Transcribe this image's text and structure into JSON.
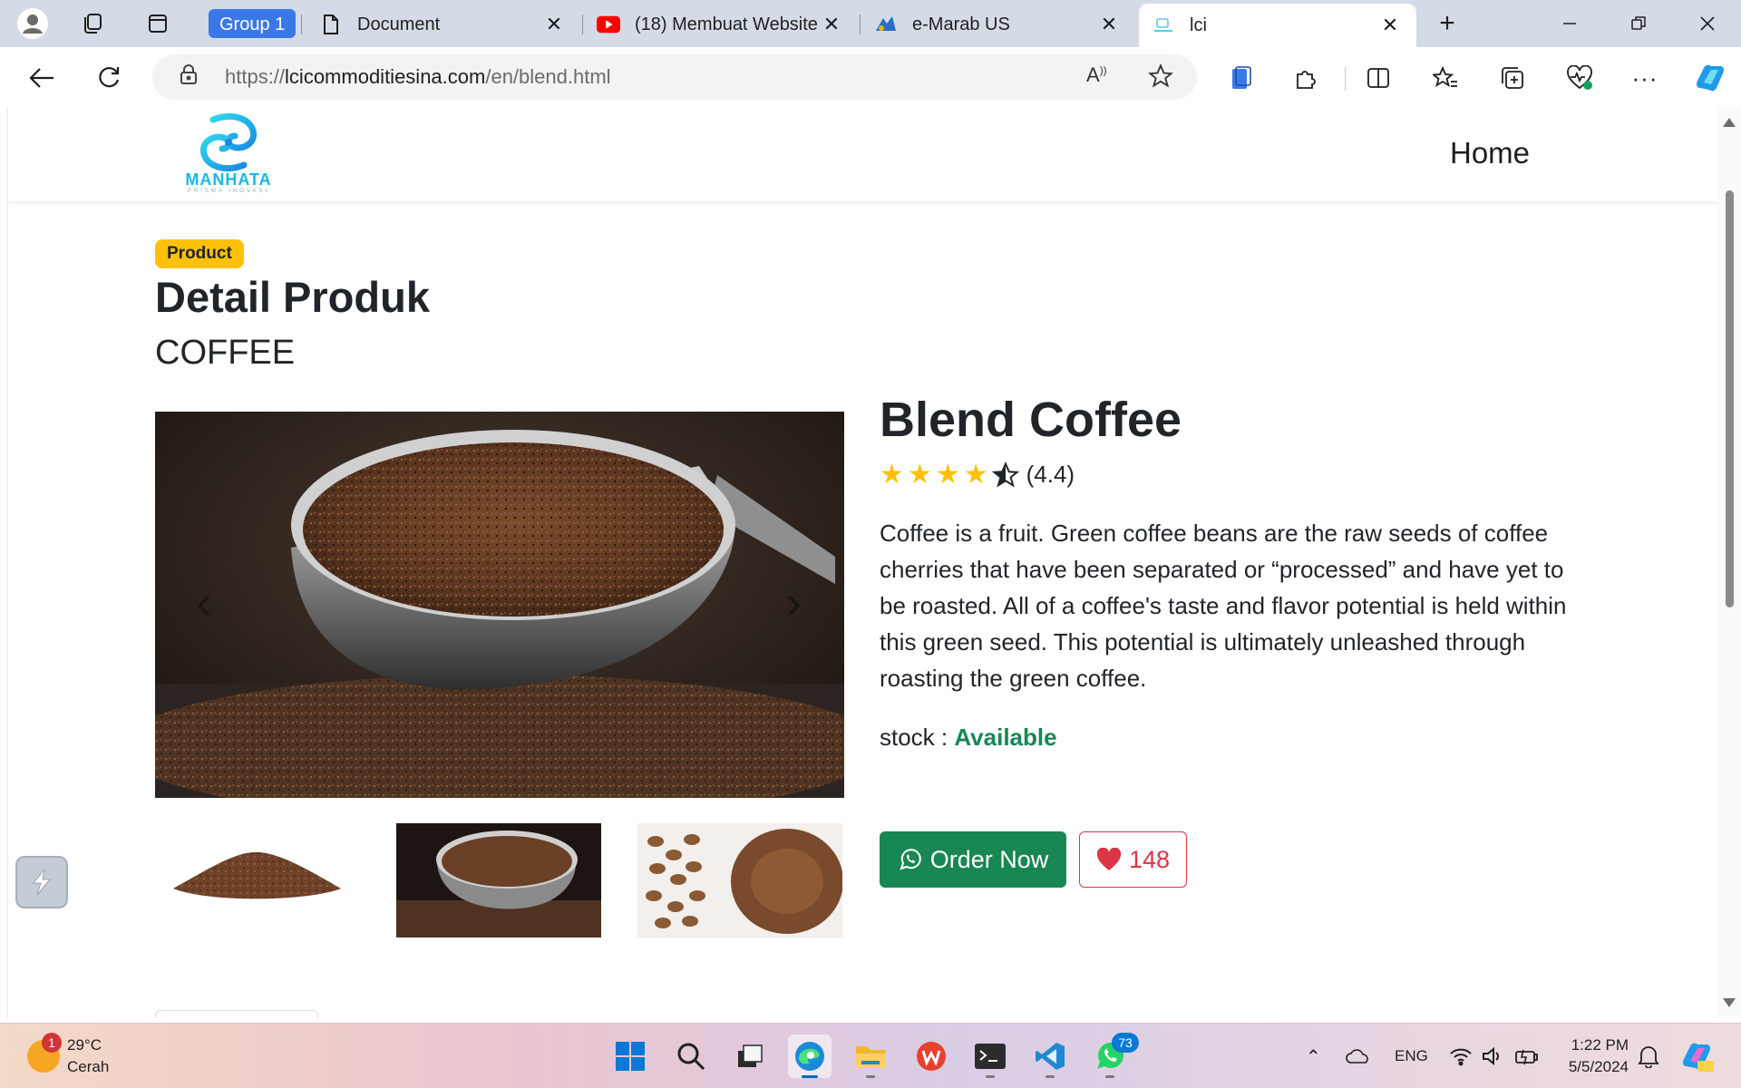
{
  "browser": {
    "tab_group": "Group 1",
    "tabs": [
      {
        "title": "Document",
        "icon": "document-icon"
      },
      {
        "title": "(18) Membuat Website",
        "icon": "youtube-icon"
      },
      {
        "title": "e-Marab US",
        "icon": "app-icon"
      },
      {
        "title": "lci",
        "icon": "page-icon",
        "active": true
      }
    ],
    "url_prefix": "https://",
    "url_host": "lcicommoditiesina.com",
    "url_path": "/en/blend.html"
  },
  "site": {
    "logo_text": "MANHATA",
    "logo_sub": "PRISMA INOVASI",
    "nav_home": "Home"
  },
  "page": {
    "badge": "Product",
    "heading": "Detail Produk",
    "category": "COFFEE",
    "product_title": "Blend Coffee",
    "rating": 4.4,
    "rating_text": "(4.4)",
    "description": "Coffee is a fruit. Green coffee beans are the raw seeds of coffee cherries that have been separated or “processed” and have yet to be roasted. All of a coffee's taste and flavor potential is held within this green seed. This potential is ultimately unleashed through roasting the green coffee.",
    "stock_label": "stock : ",
    "stock_value": "Available",
    "order_button": "Order Now",
    "likes": "148",
    "colors": {
      "badge": "#ffc107",
      "success": "#198754",
      "danger": "#dc3545"
    }
  },
  "taskbar": {
    "temperature": "29°C",
    "weather": "Cerah",
    "weather_badge": "1",
    "whatsapp_badge": "73",
    "lang": "ENG",
    "time": "1:22 PM",
    "date": "5/5/2024"
  }
}
